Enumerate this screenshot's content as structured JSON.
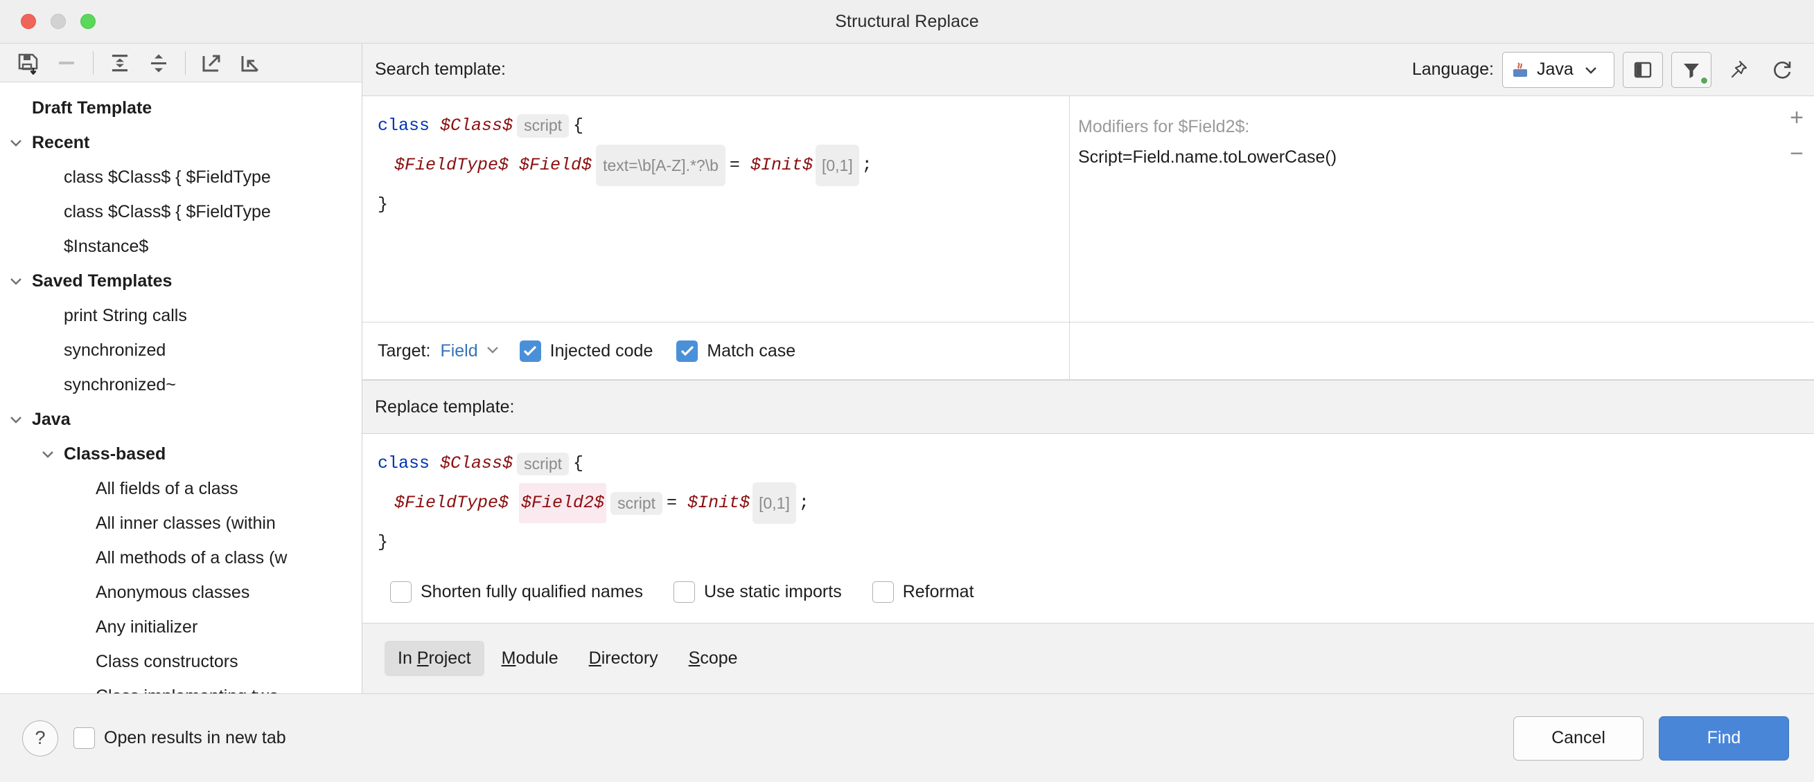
{
  "window": {
    "title": "Structural Replace"
  },
  "traffic_lights": {
    "close": "close-button",
    "minimize": "minimize-button",
    "zoom": "zoom-button"
  },
  "sidebar": {
    "toolbar": [
      {
        "name": "save-template-icon",
        "tooltip": "Save template"
      },
      {
        "name": "remove-template-icon",
        "tooltip": "Remove template"
      },
      {
        "name": "expand-all-icon",
        "tooltip": "Expand all"
      },
      {
        "name": "collapse-all-icon",
        "tooltip": "Collapse all"
      },
      {
        "name": "export-icon",
        "tooltip": "Export"
      },
      {
        "name": "import-icon",
        "tooltip": "Import"
      }
    ],
    "tree": [
      {
        "label": "Draft Template",
        "level": 0,
        "group": true,
        "arrow": "none"
      },
      {
        "label": "Recent",
        "level": 0,
        "group": true,
        "arrow": "expanded"
      },
      {
        "label": "class $Class$ {  $FieldType",
        "level": 1,
        "group": false,
        "arrow": "none"
      },
      {
        "label": "class $Class$ {  $FieldType",
        "level": 1,
        "group": false,
        "arrow": "none"
      },
      {
        "label": "$Instance$",
        "level": 1,
        "group": false,
        "arrow": "none"
      },
      {
        "label": "Saved Templates",
        "level": 0,
        "group": true,
        "arrow": "expanded"
      },
      {
        "label": "print String calls",
        "level": 1,
        "group": false,
        "arrow": "none"
      },
      {
        "label": "synchronized",
        "level": 1,
        "group": false,
        "arrow": "none"
      },
      {
        "label": "synchronized~",
        "level": 1,
        "group": false,
        "arrow": "none"
      },
      {
        "label": "Java",
        "level": 0,
        "group": true,
        "arrow": "expanded"
      },
      {
        "label": "Class-based",
        "level": 1,
        "group": true,
        "arrow": "expanded"
      },
      {
        "label": "All fields of a class",
        "level": 2,
        "group": false,
        "arrow": "none"
      },
      {
        "label": "All inner classes (within",
        "level": 2,
        "group": false,
        "arrow": "none"
      },
      {
        "label": "All methods of a class (w",
        "level": 2,
        "group": false,
        "arrow": "none"
      },
      {
        "label": "Anonymous classes",
        "level": 2,
        "group": false,
        "arrow": "none"
      },
      {
        "label": "Any initializer",
        "level": 2,
        "group": false,
        "arrow": "none"
      },
      {
        "label": "Class constructors",
        "level": 2,
        "group": false,
        "arrow": "none"
      },
      {
        "label": "Class implementing two",
        "level": 2,
        "group": false,
        "arrow": "none"
      }
    ]
  },
  "search_panel": {
    "title": "Search template:",
    "language_label": "Language:",
    "language_value": "Java",
    "toolbar_icons": [
      {
        "name": "toggle-modifiers-panel-icon"
      },
      {
        "name": "filter-icon"
      },
      {
        "name": "pin-icon"
      },
      {
        "name": "reset-icon"
      }
    ],
    "code": {
      "line1": {
        "kw": "class",
        "var": "$Class$",
        "script_badge": "script",
        "brace": "{"
      },
      "line2": {
        "type_var": "$FieldType$",
        "name_var": "$Field$",
        "regex_badge": "text=\\b[A-Z].*?\\b",
        "eq": "=",
        "init_var": "$Init$",
        "count_badge": "[0,1]",
        "semi": ";"
      },
      "line3": "}"
    }
  },
  "modifiers": {
    "title": "Modifiers for $Field2$:",
    "line": "Script=Field.name.toLowerCase()",
    "add_label": "+",
    "remove_label": "−"
  },
  "target_row": {
    "label": "Target:",
    "value": "Field",
    "checkboxes": [
      {
        "label": "Injected code",
        "checked": true
      },
      {
        "label": "Match case",
        "checked": true
      }
    ]
  },
  "replace_panel": {
    "title": "Replace template:",
    "code": {
      "line1": {
        "kw": "class",
        "var": "$Class$",
        "script_badge": "script",
        "brace": "{"
      },
      "line2": {
        "type_var": "$FieldType$",
        "name_var": "$Field2$",
        "script_badge": "script",
        "eq": "=",
        "init_var": "$Init$",
        "count_badge": "[0,1]",
        "semi": ";"
      },
      "line3": "}"
    },
    "options": [
      {
        "label": "Shorten fully qualified names",
        "checked": false
      },
      {
        "label": "Use static imports",
        "checked": false
      },
      {
        "label": "Reformat",
        "checked": false
      }
    ]
  },
  "scope": {
    "tabs": [
      {
        "label": "In Project",
        "mnemonic": "P",
        "active": true
      },
      {
        "label": "Module",
        "mnemonic": "M",
        "active": false
      },
      {
        "label": "Directory",
        "mnemonic": "D",
        "active": false
      },
      {
        "label": "Scope",
        "mnemonic": "S",
        "active": false
      }
    ]
  },
  "footer": {
    "help_label": "?",
    "open_new_tab": {
      "label": "Open results in new tab",
      "checked": false
    },
    "cancel_label": "Cancel",
    "find_label": "Find"
  },
  "colors": {
    "accent": "#4a86d8",
    "checkbox_checked": "#4a90d9",
    "keyword": "#0033b3",
    "variable": "#8b0f0f",
    "link": "#3574b5",
    "badge_bg": "#eeeeee",
    "panel_bg": "#f2f2f2"
  }
}
